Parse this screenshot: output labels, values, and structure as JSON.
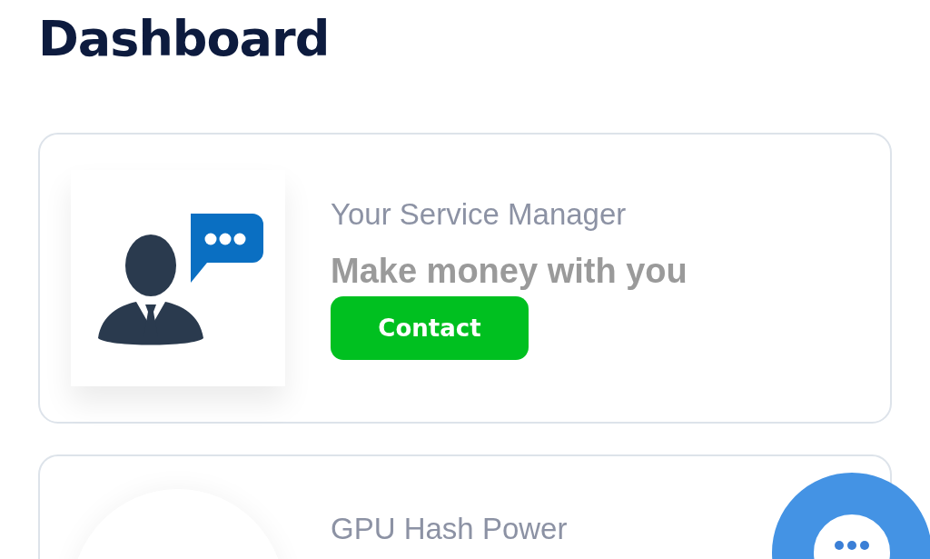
{
  "page_title": "Dashboard",
  "cards": [
    {
      "kind": "manager",
      "title": "Your Service Manager",
      "headline": "Make money with you",
      "button": "Contact"
    },
    {
      "kind": "gpu",
      "title": "GPU Hash Power"
    }
  ]
}
